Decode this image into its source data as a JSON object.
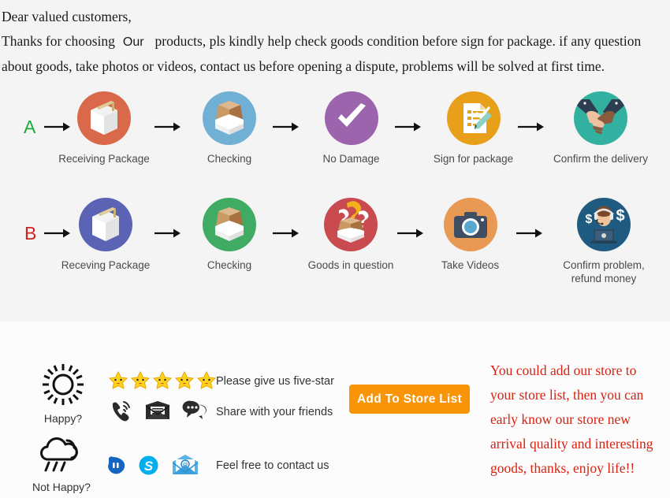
{
  "intro": {
    "line1": "Dear valued customers,",
    "line2_before": "Thanks for choosing",
    "line2_our": "Our",
    "line2_after": "products, pls kindly help check goods condition before sign for package. if any question",
    "line3": "about goods, take photos or videos, contact us before opening a dispute, problems will be solved at first time."
  },
  "flow": {
    "row_a": {
      "letter": "A",
      "letter_color": "#1faa3c",
      "steps": [
        {
          "label": "Receiving Package",
          "icon": "sealed-box-icon",
          "circle_color": "#d9694a"
        },
        {
          "label": "Checking",
          "icon": "open-box-icon",
          "circle_color": "#6fb0d4"
        },
        {
          "label": "No Damage",
          "icon": "checkmark-icon",
          "circle_color": "#9b64ad"
        },
        {
          "label": "Sign for package",
          "icon": "signed-document-icon",
          "circle_color": "#e8a01b"
        },
        {
          "label": "Confirm the delivery",
          "icon": "handshake-icon",
          "circle_color": "#33b1a0"
        }
      ]
    },
    "row_b": {
      "letter": "B",
      "letter_color": "#d32020",
      "steps": [
        {
          "label": "Receving Package",
          "icon": "sealed-box-icon",
          "circle_color": "#5a63b4"
        },
        {
          "label": "Checking",
          "icon": "open-box-icon",
          "circle_color": "#40ab63"
        },
        {
          "label": "Goods in question",
          "icon": "question-box-icon",
          "circle_color": "#c94a4f"
        },
        {
          "label": "Take Videos",
          "icon": "camera-icon",
          "circle_color": "#e89a54"
        },
        {
          "label": "Confirm problem,\nrefund money",
          "icon": "support-agent-icon",
          "circle_color": "#1f5b80"
        }
      ]
    }
  },
  "bottom": {
    "happy": {
      "label": "Happy?",
      "icon": "sun-icon"
    },
    "not_happy": {
      "label": "Not Happy?",
      "icon": "rain-cloud-icon"
    },
    "stars_count": 5,
    "star_icon": "star-icon",
    "messages": {
      "five_star": "Please give us five-star",
      "share": "Share with your friends",
      "contact": "Feel free to contact us"
    },
    "contact_icons_top": [
      "phone-ringing-icon",
      "envelope-icon",
      "chat-bubble-icon"
    ],
    "contact_icons_bottom": [
      "aliwangwang-icon",
      "skype-icon",
      "email-icon"
    ],
    "store_button": {
      "label": "Add To Store List",
      "color": "#f89406"
    },
    "promo": {
      "color": "#d92211",
      "line1": "You could add our store to",
      "line2": "your store list, then you can",
      "line3": "early know our store new",
      "line4": "arrival quality and interesting",
      "line5": "goods, thanks, enjoy life!!"
    }
  }
}
